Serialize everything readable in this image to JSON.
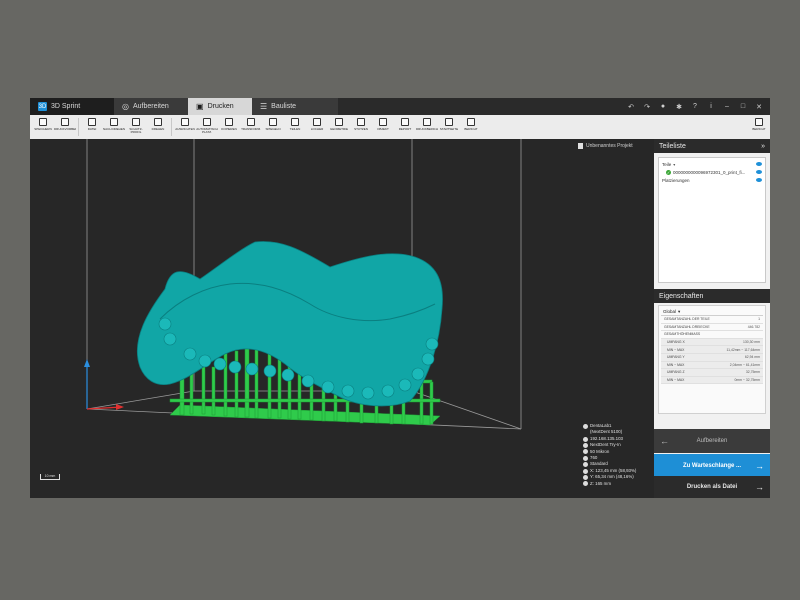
{
  "titlebar": {
    "app_name": "3D Sprint",
    "tabs": [
      {
        "label": "Aufbereiten",
        "icon": "globe-icon"
      },
      {
        "label": "Drucken",
        "icon": "printer-icon"
      },
      {
        "label": "Bauliste",
        "icon": "list-icon"
      }
    ],
    "window_controls": [
      "undo-icon",
      "redo-icon",
      "check-icon",
      "gear-icon",
      "help-icon",
      "info-icon",
      "minimize-icon",
      "maximize-icon",
      "close-icon"
    ]
  },
  "toolbar": {
    "tools": [
      "SPEICHERN",
      "DRUCKVORBEREITUNG",
      "DATEI",
      "NACH DREHEN",
      "SCHUTZ­PROFIL",
      "DREHEN",
      "AUSRICHTEN",
      "AUTOMATISCH PLATZ.",
      "KOPIEREN",
      "TRANSFORM.",
      "SPIEGELN",
      "TEILEN",
      "LÖCHER",
      "GEOMETRIE",
      "STÜTZEN",
      "OBJEKT",
      "REPORT",
      "DRUCKBERICHT",
      "STARTSEITE",
      "BERICHT"
    ],
    "right_tool": "BERICHT"
  },
  "viewport": {
    "project_name": "Unbenanntes Projekt",
    "scale_label": "10 mm",
    "printer_info": [
      "DentaLab1",
      "(NextDent 5100)",
      "192.168.135.103",
      "NextDent Try-In",
      "50 Mikron",
      "760",
      "Standard",
      "X: 123,45 mm (58,93%)",
      "Y: 65,34 mm (48,16%)",
      "Z: 165 mm"
    ]
  },
  "panel": {
    "teileliste_title": "Teileliste",
    "collapse_icon": "double-chevron-right-icon",
    "rows": [
      {
        "label": "Teile",
        "type": "group"
      },
      {
        "label": "0000000000096972301_0_print_fi...",
        "type": "part"
      },
      {
        "label": "Platzierungen",
        "type": "group"
      }
    ],
    "eigenschaften_title": "Eigenschaften",
    "select_value": "Global",
    "properties": [
      {
        "label": "GESAMTANZAHL DER TEILE",
        "value": "1",
        "sub": false
      },
      {
        "label": "GESAMTANZAHL DREIECKE",
        "value": "446.782",
        "sub": false
      },
      {
        "label": "GESAMTHÖHENMAß",
        "value": "",
        "sub": false
      },
      {
        "label": "Umfang X",
        "value": "130,30 mm",
        "sub": true
      },
      {
        "label": "Min ~ Max",
        "value": "11,42mm ~ 117,64mm",
        "sub": true
      },
      {
        "label": "Umfang Y",
        "value": "62,94 mm",
        "sub": true
      },
      {
        "label": "Min ~ Max",
        "value": "2,04mm ~ 61,41mm",
        "sub": true
      },
      {
        "label": "Umfang Z",
        "value": "32,75mm",
        "sub": true
      },
      {
        "label": "Min ~ Max",
        "value": "0mm ~ 32,75mm",
        "sub": true
      }
    ],
    "actions": {
      "back": "Aufbereiten",
      "queue": "Zu Warteschlange ...",
      "file": "Drucken als Datei"
    }
  },
  "colors": {
    "accent": "#1e8fd6",
    "model": "#11a6a6",
    "supports": "#2fcb4b",
    "background": "#676763"
  }
}
